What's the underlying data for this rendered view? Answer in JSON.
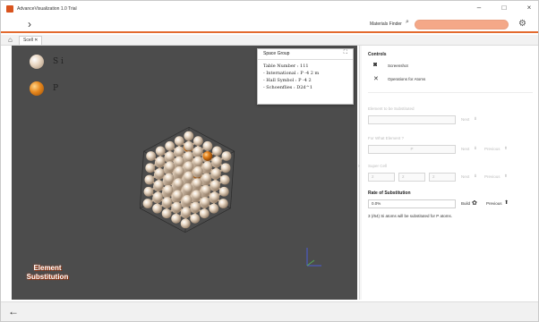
{
  "window": {
    "title": "AdvanceVisualization 1.0 Trial",
    "minimize": "–",
    "maximize": "□",
    "close": "×"
  },
  "toolbar": {
    "menu_icon": "hamburger-icon",
    "finder_label": "Materials Finder",
    "finder_placeholder": "",
    "accent": "#e36a2e"
  },
  "tabs": [
    {
      "label": "Scell ✕"
    }
  ],
  "viewer": {
    "legend": [
      {
        "symbol": "S  i",
        "color": "#e8d5c0"
      },
      {
        "symbol": "P",
        "color": "#e5861c"
      }
    ],
    "logo_line1": "Element",
    "logo_line2": "Substitution",
    "background": "#4c4c4c"
  },
  "space_group": {
    "title": "Space Group",
    "lines": [
      "Table Number : 111",
      "- International : P -4 2 m",
      "- Hall Symbol : P -4 2",
      "- Schoenflies : D2d^1"
    ]
  },
  "controls": {
    "title": "Controls",
    "screenshot": "Screenshot",
    "operations": "Operations for Atoms",
    "element_to_substitute": {
      "label": "Element to be Substituted",
      "value": "",
      "next": "Next"
    },
    "for_what_element": {
      "label": "For What Element ?",
      "value": "P",
      "next": "Next",
      "previous": "Previous"
    },
    "super_cell": {
      "label": "Super Cell",
      "values": [
        "2",
        "2",
        "2"
      ],
      "next": "Next",
      "previous": "Previous"
    },
    "rate": {
      "label": "Rate of Substitution",
      "value": "0.0%",
      "build": "Build",
      "previous": "Previous",
      "note": "3 (/64) Si atoms will be substituted for P atoms."
    }
  }
}
